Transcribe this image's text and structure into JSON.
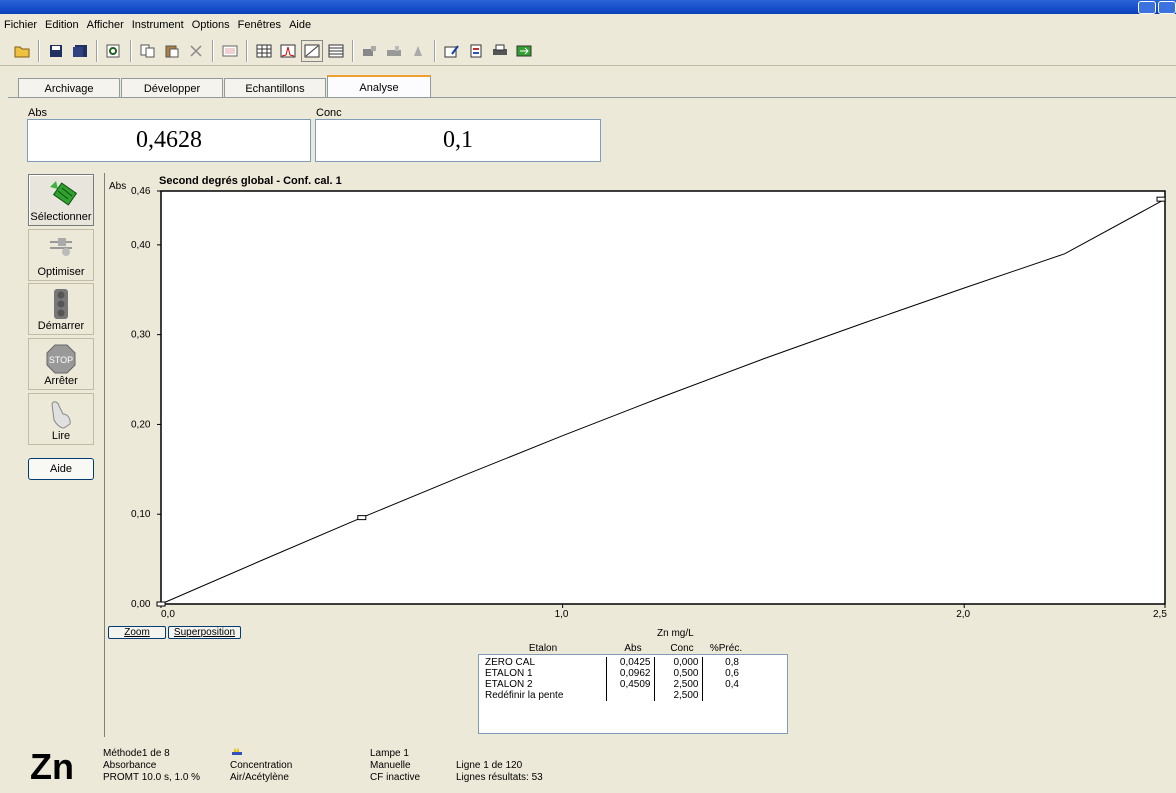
{
  "menu": [
    "Fichier",
    "Edition",
    "Afficher",
    "Instrument",
    "Options",
    "Fenêtres",
    "Aide"
  ],
  "tabs": [
    {
      "label": "Archivage",
      "active": false
    },
    {
      "label": "Développer",
      "active": false
    },
    {
      "label": "Echantillons",
      "active": false
    },
    {
      "label": "Analyse",
      "active": true
    }
  ],
  "readouts": {
    "abs_label": "Abs",
    "abs_value": "0,4628",
    "conc_label": "Conc",
    "conc_value": "0,1"
  },
  "side_buttons": [
    {
      "label": "Sélectionner",
      "icon": "select-icon"
    },
    {
      "label": "Optimiser",
      "icon": "optimize-icon"
    },
    {
      "label": "Démarrer",
      "icon": "traffic-light-icon"
    },
    {
      "label": "Arrêter",
      "icon": "stop-sign-icon"
    },
    {
      "label": "Lire",
      "icon": "hand-icon"
    }
  ],
  "aide_label": "Aide",
  "zoom_label": "Zoom",
  "superposition_label": "Superposition",
  "chart_data": {
    "type": "line",
    "title": "Second degrés global - Conf. cal. 1",
    "ylabel": "Abs",
    "xlabel": "Zn mg/L",
    "xlim": [
      0.0,
      2.5
    ],
    "ylim": [
      0.0,
      0.46
    ],
    "x_ticks": [
      "0,0",
      "1,0",
      "2,0",
      "2,5"
    ],
    "y_ticks": [
      "0,00",
      "0,10",
      "0,20",
      "0,30",
      "0,40",
      "0,46"
    ],
    "curve": {
      "x": [
        0.0,
        0.25,
        0.5,
        0.75,
        1.0,
        1.25,
        1.5,
        1.75,
        2.0,
        2.25,
        2.5
      ],
      "y": [
        0.0,
        0.0485,
        0.0962,
        0.1425,
        0.1875,
        0.231,
        0.273,
        0.313,
        0.352,
        0.39,
        0.4509
      ]
    },
    "points": [
      {
        "x": 0.0,
        "y": 0.0
      },
      {
        "x": 0.5,
        "y": 0.0962
      },
      {
        "x": 2.5,
        "y": 0.4509
      }
    ]
  },
  "cal_table": {
    "headers": [
      "Etalon",
      "Abs",
      "Conc",
      "%Préc."
    ],
    "rows": [
      [
        "ZERO CAL",
        "0,0425",
        "0,000",
        "0,8"
      ],
      [
        "ETALON 1",
        "0,0962",
        "0,500",
        "0,6"
      ],
      [
        "ETALON 2",
        "0,4509",
        "2,500",
        "0,4"
      ],
      [
        "Redéfinir la pente",
        "",
        "2,500",
        ""
      ]
    ]
  },
  "status": {
    "element": "Zn",
    "col1": [
      "Méthode1 de 8",
      "Absorbance",
      "PROMT 10.0 s, 1.0 %"
    ],
    "col2": [
      "",
      "Concentration",
      "Air/Acétylène"
    ],
    "col3": [
      "Lampe 1",
      "Manuelle",
      "CF inactive"
    ],
    "col4": [
      "",
      "Ligne 1 de 120",
      "Lignes résultats: 53"
    ]
  }
}
